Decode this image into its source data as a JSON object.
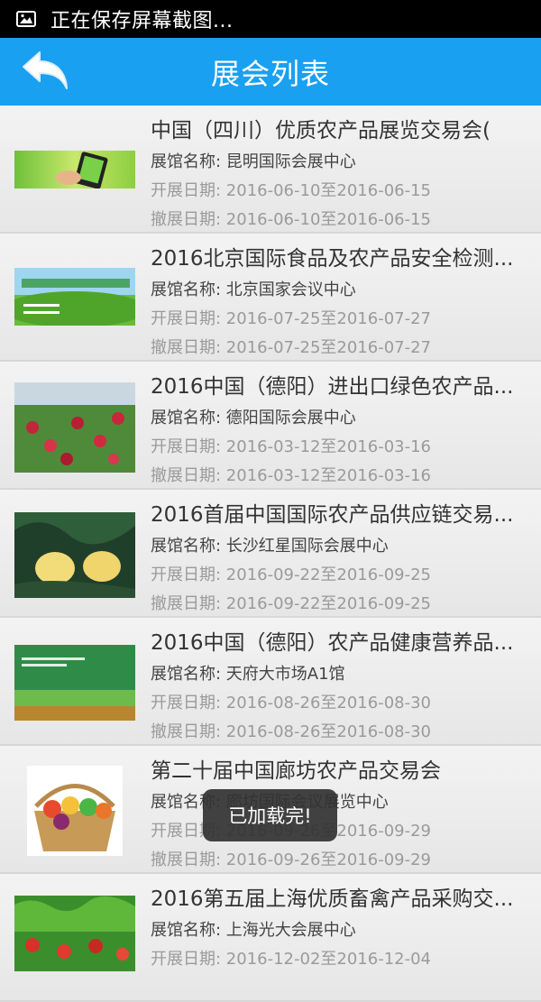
{
  "status_bar": {
    "notification_text": "正在保存屏幕截图...",
    "icon": "image-icon"
  },
  "header": {
    "title": "展会列表",
    "back_icon": "back-arrow-icon"
  },
  "list": {
    "items": [
      {
        "title": "中国（四川）优质农产品展览交易会(",
        "venue": "展馆名称: 昆明国际会展中心",
        "start": "开展日期: 2016-06-10至2016-06-15",
        "end": "撤展日期: 2016-06-10至2016-06-15"
      },
      {
        "title": "2016北京国际食品及农产品安全检测...",
        "venue": "展馆名称: 北京国家会议中心",
        "start": "开展日期: 2016-07-25至2016-07-27",
        "end": "撤展日期: 2016-07-25至2016-07-27"
      },
      {
        "title": "2016中国（德阳）进出口绿色农产品...",
        "venue": "展馆名称: 德阳国际会展中心",
        "start": "开展日期: 2016-03-12至2016-03-16",
        "end": "撤展日期: 2016-03-12至2016-03-16"
      },
      {
        "title": "2016首届中国国际农产品供应链交易...",
        "venue": "展馆名称: 长沙红星国际会展中心",
        "start": "开展日期: 2016-09-22至2016-09-25",
        "end": "撤展日期: 2016-09-22至2016-09-25"
      },
      {
        "title": "2016中国（德阳）农产品健康营养品...",
        "venue": "展馆名称: 天府大市场A1馆",
        "start": "开展日期: 2016-08-26至2016-08-30",
        "end": "撤展日期: 2016-08-26至2016-08-30"
      },
      {
        "title": "第二十届中国廊坊农产品交易会",
        "venue": "展馆名称: 廊坊国际会议展览中心",
        "start": "开展日期: 2016-09-26至2016-09-29",
        "end": "撤展日期: 2016-09-26至2016-09-29"
      },
      {
        "title": "2016第五届上海优质畜禽产品采购交...",
        "venue": "展馆名称: 上海光大会展中心",
        "start": "开展日期: 2016-12-02至2016-12-04",
        "end": ""
      }
    ]
  },
  "toast": {
    "text": "已加载完!"
  },
  "colors": {
    "header_bg": "#1aa0f0",
    "status_bg": "#000000"
  }
}
